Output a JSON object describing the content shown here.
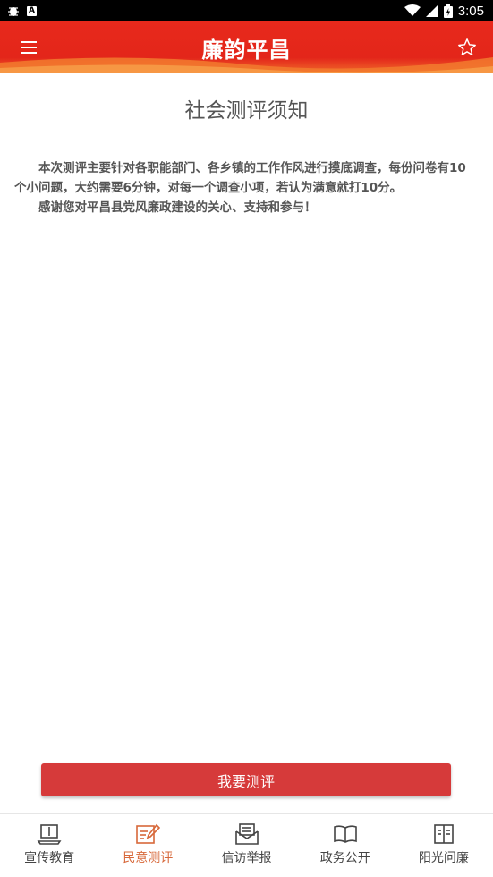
{
  "status_bar": {
    "time": "3:05",
    "icons": [
      "bug-icon",
      "a-notification-icon",
      "wifi-icon",
      "signal-icon",
      "battery-icon"
    ]
  },
  "header": {
    "title": "廉韵平昌",
    "menu_icon": "hamburger-icon",
    "favorite_icon": "star-outline-icon",
    "background_color": "#e3261a"
  },
  "page": {
    "title": "社会测评须知",
    "paragraphs": [
      "本次测评主要针对各职能部门、各乡镇的工作作风进行摸底调查，每份问卷有10个小问题，大约需要6分钟，对每一个调查小项，若认为满意就打10分。",
      "感谢您对平昌县党风廉政建设的关心、支持和参与！"
    ]
  },
  "action": {
    "label": "我要测评",
    "color": "#d63a3a"
  },
  "bottom_nav": {
    "active_color": "#d7683a",
    "items": [
      {
        "label": "宣传教育",
        "icon": "laptop-book-icon",
        "active": false
      },
      {
        "label": "民意测评",
        "icon": "edit-note-icon",
        "active": true
      },
      {
        "label": "信访举报",
        "icon": "mail-report-icon",
        "active": false
      },
      {
        "label": "政务公开",
        "icon": "open-book-icon",
        "active": false
      },
      {
        "label": "阳光问廉",
        "icon": "document-book-icon",
        "active": false
      }
    ]
  }
}
